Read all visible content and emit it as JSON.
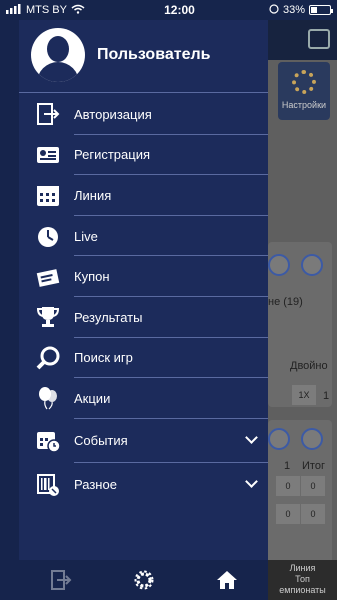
{
  "status_bar": {
    "carrier": "MTS BY",
    "time": "12:00",
    "battery": "33%"
  },
  "profile": {
    "name": "Пользователь"
  },
  "menu": [
    {
      "label": "Авторизация",
      "icon": "login-icon"
    },
    {
      "label": "Регистрация",
      "icon": "id-card-icon"
    },
    {
      "label": "Линия",
      "icon": "calendar-icon"
    },
    {
      "label": "Live",
      "icon": "stopwatch-icon"
    },
    {
      "label": "Купон",
      "icon": "ticket-icon"
    },
    {
      "label": "Результаты",
      "icon": "trophy-icon"
    },
    {
      "label": "Поиск игр",
      "icon": "search-icon"
    },
    {
      "label": "Акции",
      "icon": "balloons-icon"
    },
    {
      "label": "События",
      "icon": "calendar-clock-icon"
    },
    {
      "label": "Разное",
      "icon": "barcode-phone-icon"
    }
  ],
  "background": {
    "settings_label": "Настройки",
    "text_ne": "не (19)",
    "text_dvoyno": "Двойно",
    "cell_1x": "1X",
    "cell_1": "1",
    "text_1": "1",
    "text_itog": "Итог",
    "cell_0a": "0",
    "cell_0b": "0",
    "cell_0c": "0",
    "cell_0d": "0",
    "bottom_line": "Линия",
    "bottom_top": "Топ",
    "bottom_champ": "емпионаты"
  },
  "colors": {
    "drawer_bg": "#1c2b5b",
    "divider": "#5a6aa0"
  }
}
